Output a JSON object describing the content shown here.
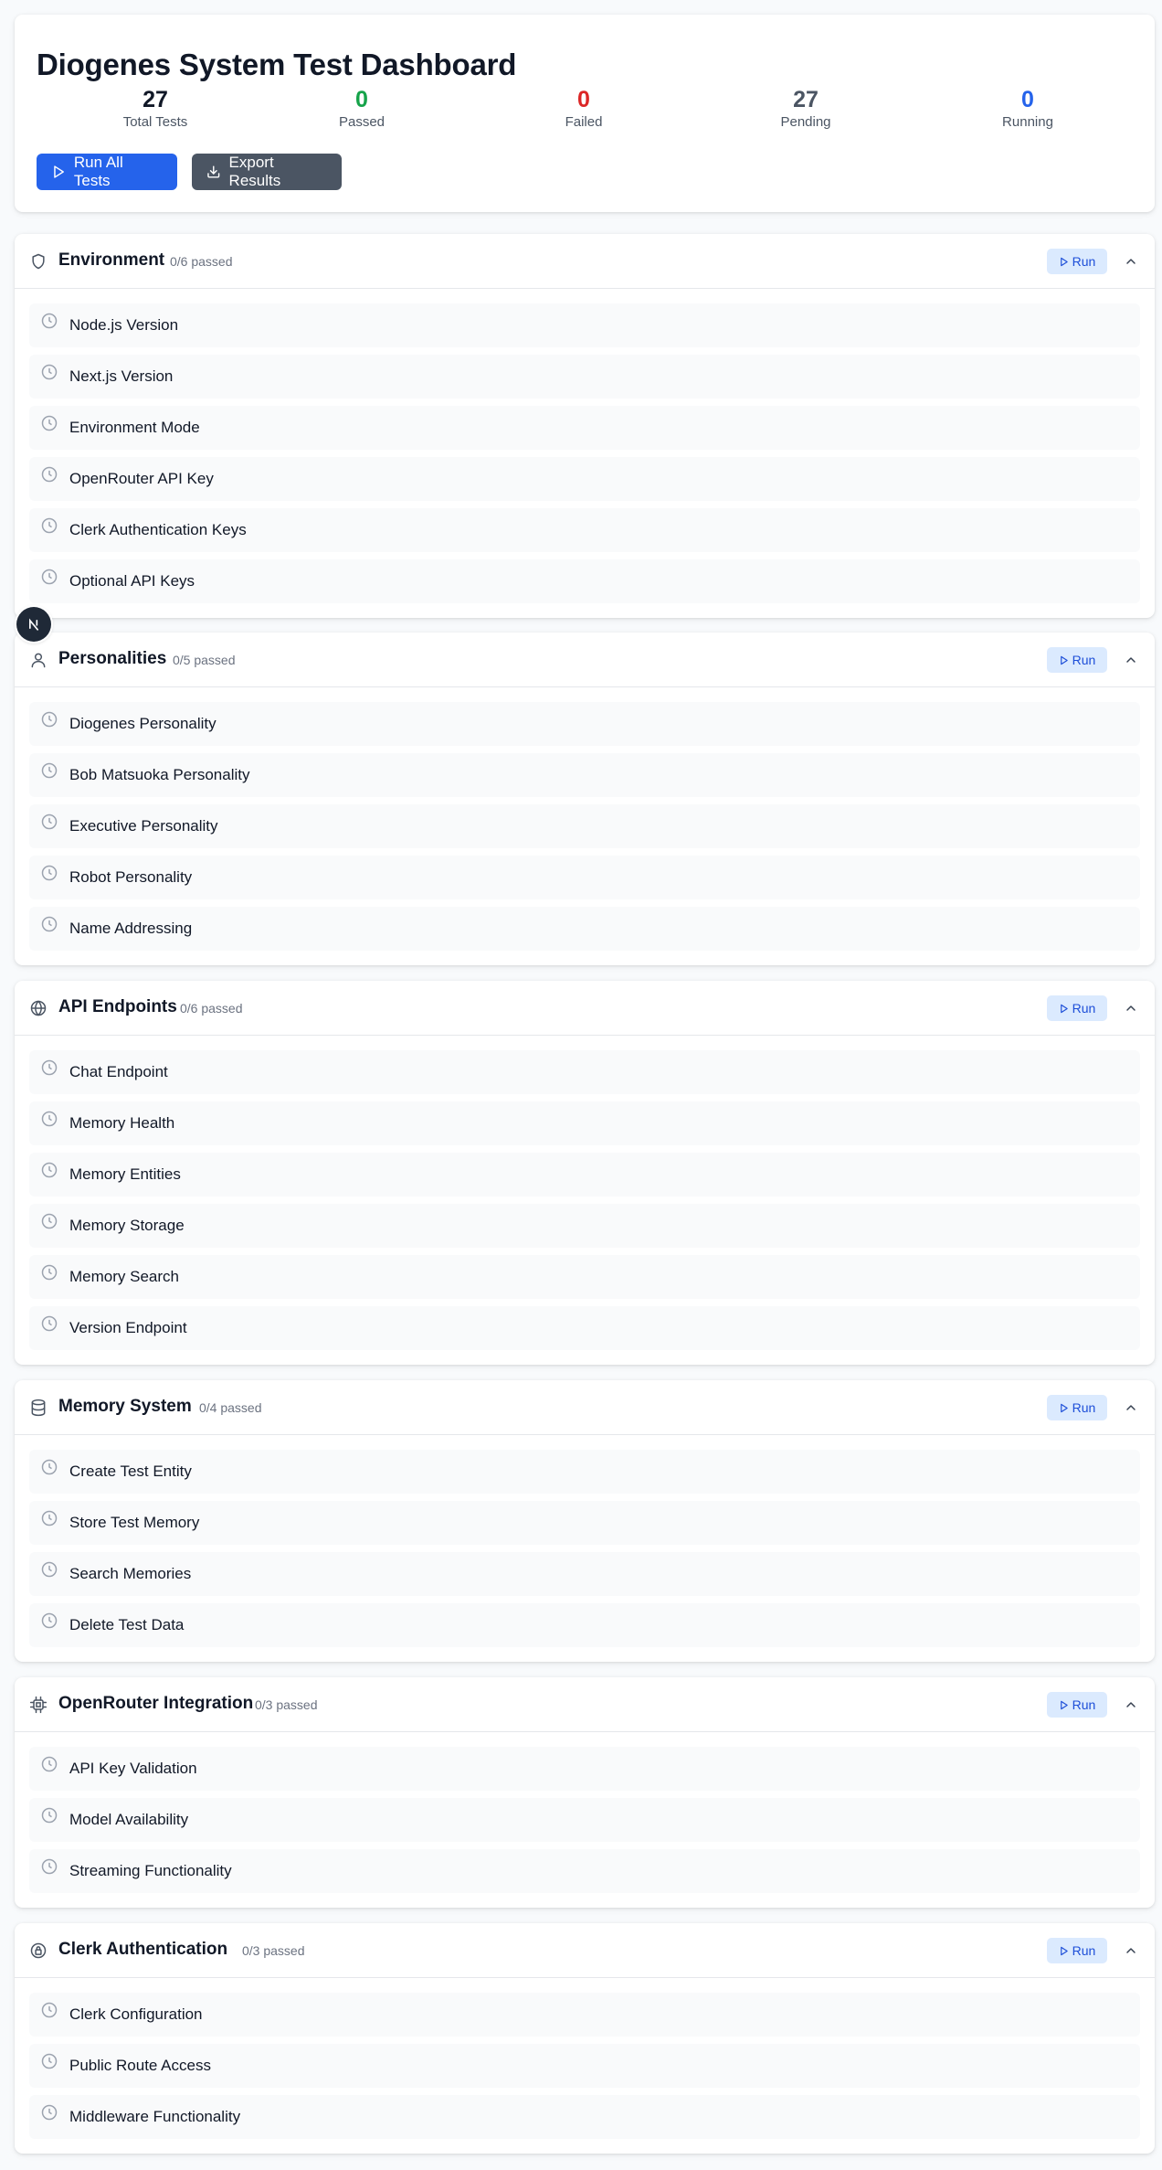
{
  "dashboard": {
    "title": "Diogenes System Test Dashboard",
    "stats": [
      {
        "value": "27",
        "label": "Total Tests",
        "color": "#111827"
      },
      {
        "value": "0",
        "label": "Passed",
        "color": "#16a34a"
      },
      {
        "value": "0",
        "label": "Failed",
        "color": "#dc2626"
      },
      {
        "value": "27",
        "label": "Pending",
        "color": "#4b5563"
      },
      {
        "value": "0",
        "label": "Running",
        "color": "#2563eb"
      }
    ],
    "run_all_label": "Run All Tests",
    "export_label": "Export Results"
  },
  "run_label": "Run",
  "sections": [
    {
      "title": "Environment",
      "count": "0/6 passed",
      "icon": "shield-icon",
      "tests": [
        "Node.js Version",
        "Next.js Version",
        "Environment Mode",
        "OpenRouter API Key",
        "Clerk Authentication Keys",
        "Optional API Keys"
      ]
    },
    {
      "title": "Personalities",
      "count": "0/5 passed",
      "icon": "user-icon",
      "tests": [
        "Diogenes Personality",
        "Bob Matsuoka Personality",
        "Executive Personality",
        "Robot Personality",
        "Name Addressing"
      ]
    },
    {
      "title": "API Endpoints",
      "count": "0/6 passed",
      "icon": "globe-icon",
      "tests": [
        "Chat Endpoint",
        "Memory Health",
        "Memory Entities",
        "Memory Storage",
        "Memory Search",
        "Version Endpoint"
      ]
    },
    {
      "title": "Memory System",
      "count": "0/4 passed",
      "icon": "database-icon",
      "tests": [
        "Create Test Entity",
        "Store Test Memory",
        "Search Memories",
        "Delete Test Data"
      ]
    },
    {
      "title": "OpenRouter Integration",
      "count": "0/3 passed",
      "icon": "cpu-icon",
      "tests": [
        "API Key Validation",
        "Model Availability",
        "Streaming Functionality"
      ]
    },
    {
      "title": "Clerk Authentication",
      "count": "0/3 passed",
      "icon": "lock-icon",
      "tests": [
        "Clerk Configuration",
        "Public Route Access",
        "Middleware Functionality"
      ]
    }
  ],
  "theme": {
    "primary": "#2563eb",
    "secondary": "#4b5563",
    "run_bg": "#dbeafe",
    "run_text": "#1d4ed8",
    "pending_icon": "#9ca3af"
  }
}
